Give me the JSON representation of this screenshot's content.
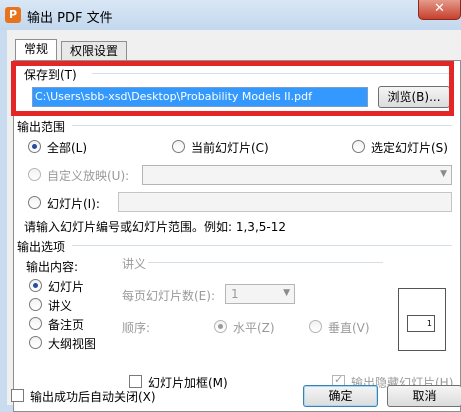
{
  "window": {
    "title": "输出 PDF 文件",
    "app_icon": "P",
    "close_glyph": "✕"
  },
  "tabs": [
    {
      "label": "常规"
    },
    {
      "label": "权限设置"
    }
  ],
  "save_to": {
    "label": "保存到(T)",
    "path": "C:\\Users\\sbb-xsd\\Desktop\\Probability Models II.pdf",
    "browse": "浏览(B)..."
  },
  "range": {
    "title": "输出范围",
    "all": "全部(L)",
    "current": "当前幻灯片(C)",
    "selected": "选定幻灯片(S)",
    "custom": "自定义放映(U):",
    "slides": "幻灯片(I):",
    "hint": "请输入幻灯片编号或幻灯片范围。例如: 1,3,5-12"
  },
  "options": {
    "title": "输出选项",
    "content_label": "输出内容:",
    "content_items": [
      "幻灯片",
      "讲义",
      "备注页",
      "大纲视图"
    ],
    "handout": {
      "title": "讲义",
      "per_page_label": "每页幻灯片数(E):",
      "per_page_value": "1",
      "order_label": "顺序:",
      "horizontal": "水平(Z)",
      "vertical": "垂直(V)",
      "preview_number": "1"
    },
    "frame": "幻灯片加框(M)",
    "hidden": "输出隐藏幻灯片(H)"
  },
  "footer": {
    "auto_close": "输出成功后自动关闭(X)",
    "ok": "确定",
    "cancel": "取消"
  }
}
